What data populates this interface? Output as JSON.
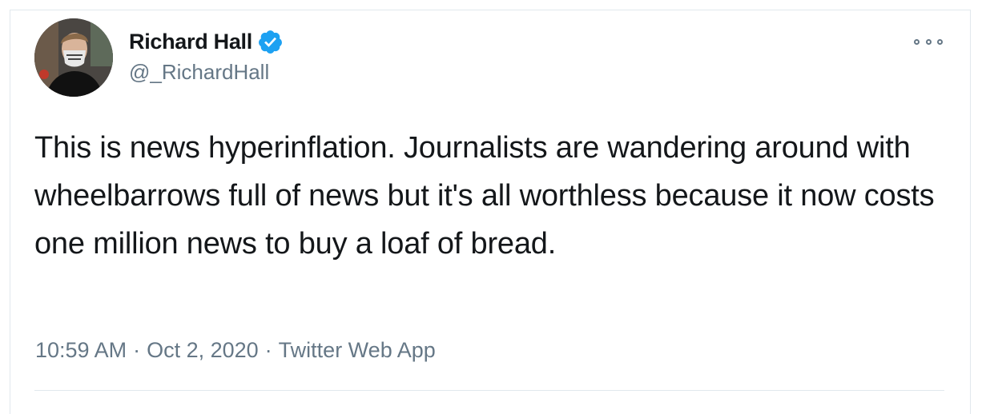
{
  "author": {
    "name": "Richard Hall",
    "handle": "@_RichardHall",
    "verified": true
  },
  "tweet": {
    "text": "This is news hyperinflation. Journalists are wandering around with wheelbarrows full of news but it's all worthless because it now costs one million news to buy a loaf of bread."
  },
  "meta": {
    "time": "10:59 AM",
    "separator": "·",
    "date": "Oct 2, 2020",
    "source": "Twitter Web App"
  },
  "icons": {
    "verified": "verified-badge-icon",
    "more": "more-options-icon"
  },
  "colors": {
    "verified_blue": "#1da1f2",
    "text": "#14171a",
    "secondary": "#657786",
    "border": "#e1e8ed"
  }
}
